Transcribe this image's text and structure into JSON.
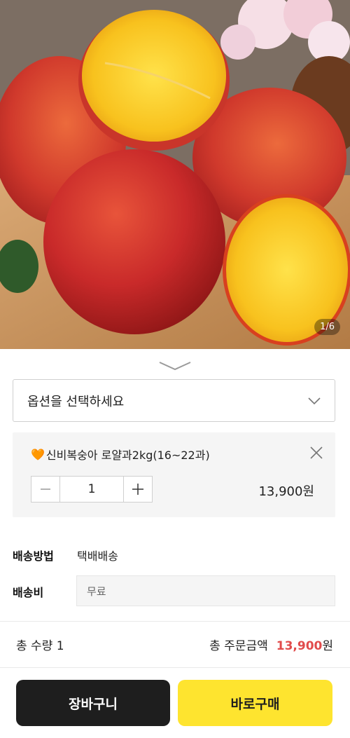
{
  "product_image": {
    "page_counter": "1/6",
    "description_icon": "nectarine-photo"
  },
  "option_select": {
    "placeholder": "옵션을 선택하세요"
  },
  "selected_option": {
    "emoji": "🧡",
    "name": "신비복숭아 로얄과2kg(16~22과)",
    "quantity": "1",
    "minus_symbol": "−",
    "plus_symbol": "+",
    "price": "13,900원"
  },
  "shipping": {
    "method_label": "배송방법",
    "method_value": "택배배송",
    "fee_label": "배송비",
    "fee_value": "무료"
  },
  "totals": {
    "quantity_label": "총 수량 1",
    "amount_label": "총 주문금액",
    "amount_value": "13,900",
    "amount_unit": "원"
  },
  "actions": {
    "cart_label": "장바구니",
    "buy_label": "바로구매"
  },
  "colors": {
    "accent_price": "#e14b4b",
    "buy_button": "#fee42f",
    "cart_button": "#1e1e1e"
  }
}
